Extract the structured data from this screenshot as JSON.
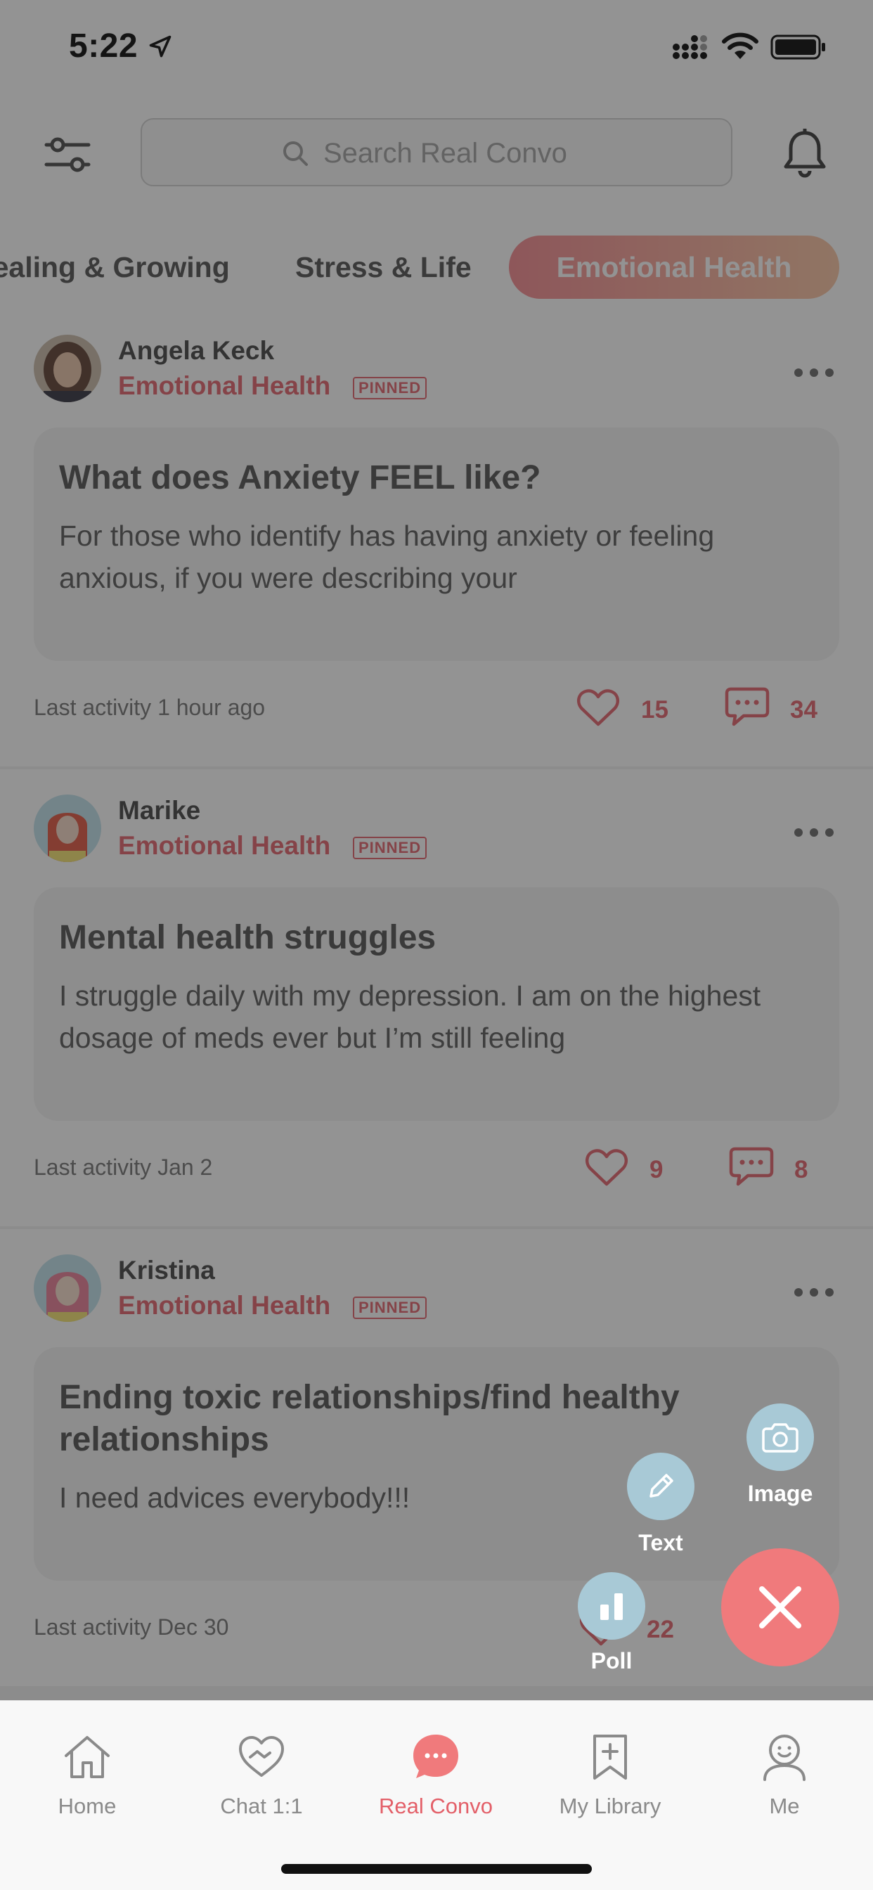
{
  "status_bar": {
    "time": "5:22"
  },
  "header": {
    "search_placeholder": "Search Real Convo",
    "tabs": [
      {
        "label": "Healing & Growing"
      },
      {
        "label": "Stress & Life"
      },
      {
        "label": "Emotional Health",
        "selected": true
      }
    ]
  },
  "posts": [
    {
      "author": "Angela Keck",
      "category": "Emotional Health",
      "badge": "PINNED",
      "title": "What does Anxiety FEEL like?",
      "body": "For those who identify has having anxiety or feeling anxious, if you were describing your",
      "last_activity": "Last activity 1 hour ago",
      "likes": "15",
      "comments": "34"
    },
    {
      "author": "Marike",
      "category": "Emotional Health",
      "badge": "PINNED",
      "title": "Mental health struggles",
      "body": "I struggle daily with my depression. I am on the highest dosage of meds ever but I’m still feeling",
      "last_activity": "Last activity Jan 2",
      "likes": "9",
      "comments": "8"
    },
    {
      "author": "Kristina",
      "category": "Emotional Health",
      "badge": "PINNED",
      "title": "Ending toxic relationships/find healthy relationships",
      "body": "I need advices everybody!!!",
      "last_activity": "Last activity Dec 30",
      "likes": "22",
      "comments": ""
    }
  ],
  "fab_menu": {
    "image_label": "Image",
    "text_label": "Text",
    "poll_label": "Poll"
  },
  "tabbar": {
    "items": [
      {
        "label": "Home",
        "icon": "home-icon"
      },
      {
        "label": "Chat 1:1",
        "icon": "handshake-icon"
      },
      {
        "label": "Real Convo",
        "icon": "chat-bubble-icon",
        "active": true
      },
      {
        "label": "My Library",
        "icon": "bookmark-plus-icon"
      },
      {
        "label": "Me",
        "icon": "profile-icon"
      }
    ]
  },
  "colors": {
    "accent": "#e35f68",
    "fab_close": "#f07a7c",
    "fab_action": "#a8c9d6",
    "overlay": "rgba(40,40,40,0.5)"
  }
}
